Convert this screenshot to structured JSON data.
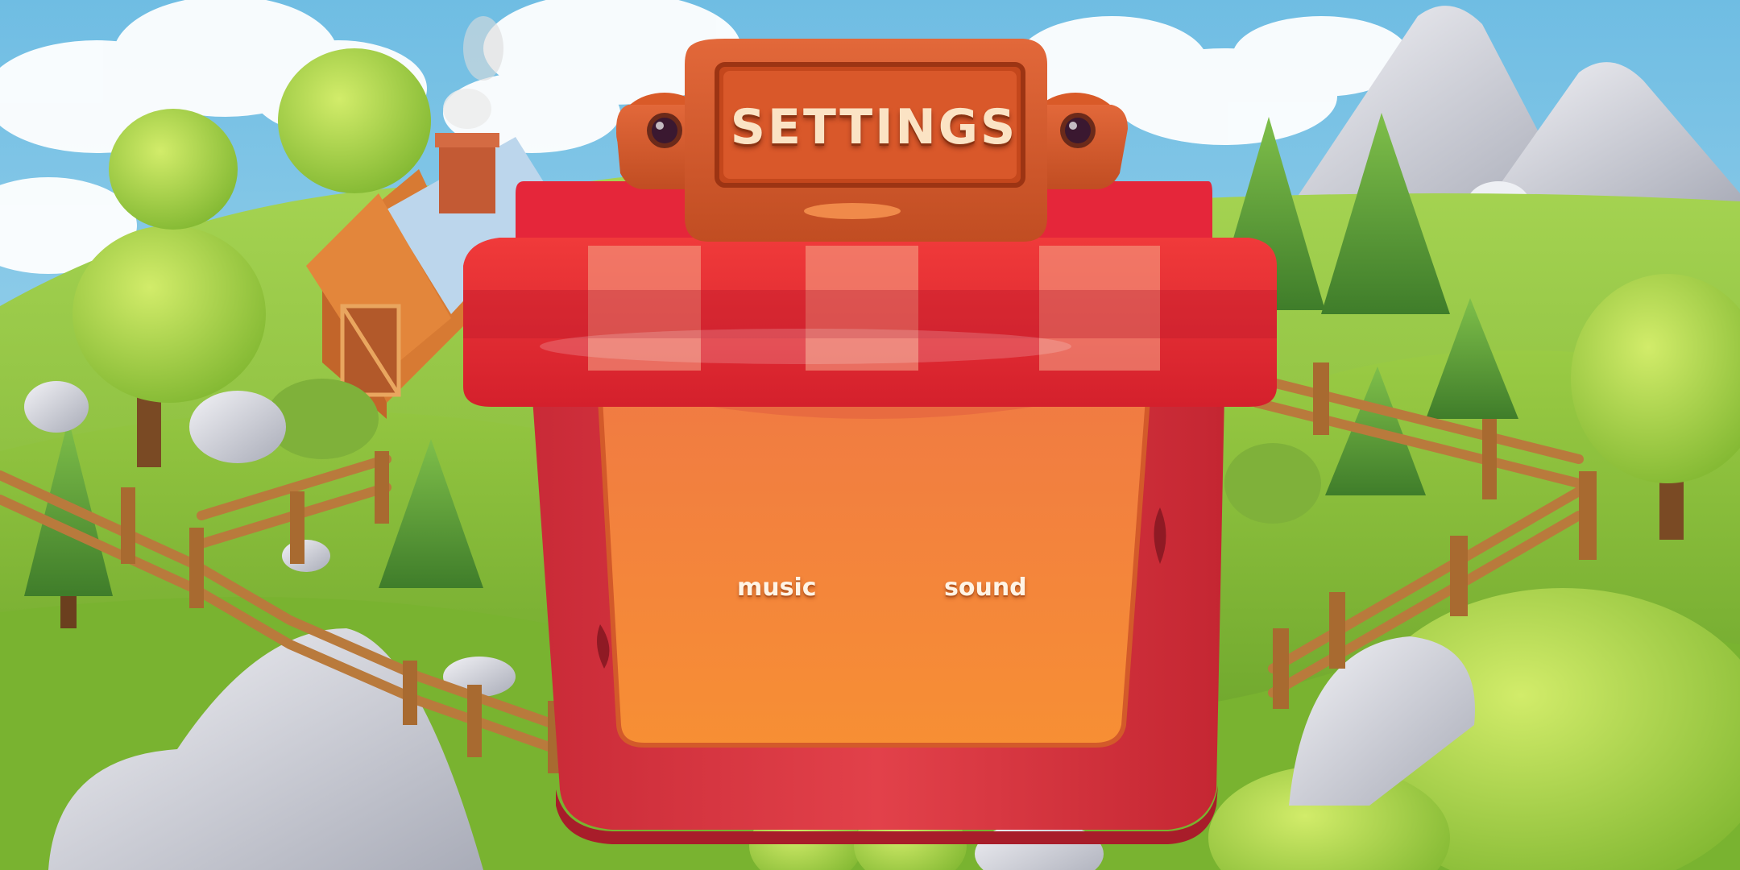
{
  "settings": {
    "title": "SETTINGS",
    "options": {
      "music_label": "music",
      "sound_label": "sound"
    }
  },
  "colors": {
    "sky": "#7fc4e6",
    "grass": "#8cc43c",
    "awning_red": "#e32a33",
    "panel_red": "#d9373f",
    "panel_orange": "#f58a3a",
    "plank": "#d75a27"
  }
}
